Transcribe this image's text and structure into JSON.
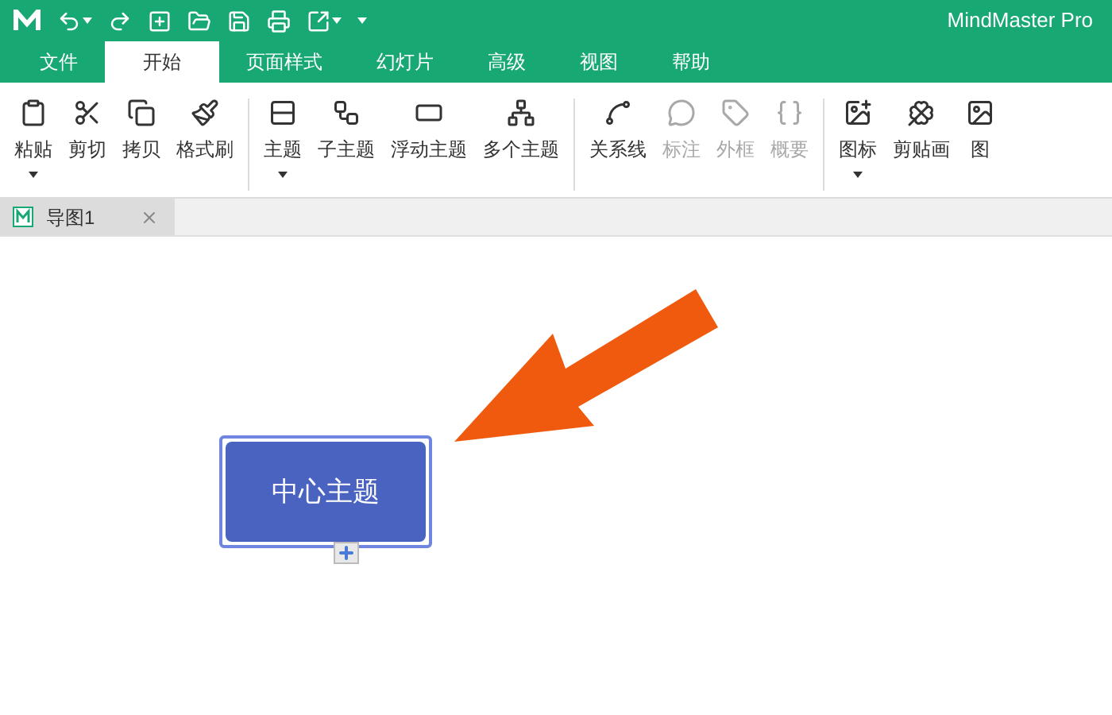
{
  "window": {
    "title": "MindMaster Pro"
  },
  "menu_tabs": [
    {
      "label": "文件",
      "selected": false
    },
    {
      "label": "开始",
      "selected": true
    },
    {
      "label": "页面样式",
      "selected": false
    },
    {
      "label": "幻灯片",
      "selected": false
    },
    {
      "label": "高级",
      "selected": false
    },
    {
      "label": "视图",
      "selected": false
    },
    {
      "label": "帮助",
      "selected": false
    }
  ],
  "ribbon_groups": [
    [
      {
        "label": "粘贴",
        "dropdown": true,
        "disabled": false
      },
      {
        "label": "剪切",
        "dropdown": false,
        "disabled": false
      },
      {
        "label": "拷贝",
        "dropdown": false,
        "disabled": false
      },
      {
        "label": "格式刷",
        "dropdown": false,
        "disabled": false
      }
    ],
    [
      {
        "label": "主题",
        "dropdown": true,
        "disabled": false
      },
      {
        "label": "子主题",
        "dropdown": false,
        "disabled": false
      },
      {
        "label": "浮动主题",
        "dropdown": false,
        "disabled": false
      },
      {
        "label": "多个主题",
        "dropdown": false,
        "disabled": false
      }
    ],
    [
      {
        "label": "关系线",
        "dropdown": false,
        "disabled": false
      },
      {
        "label": "标注",
        "dropdown": false,
        "disabled": true
      },
      {
        "label": "外框",
        "dropdown": false,
        "disabled": true
      },
      {
        "label": "概要",
        "dropdown": false,
        "disabled": true
      }
    ],
    [
      {
        "label": "图标",
        "dropdown": true,
        "disabled": false
      },
      {
        "label": "剪贴画",
        "dropdown": false,
        "disabled": false
      },
      {
        "label": "图",
        "dropdown": false,
        "disabled": false
      }
    ]
  ],
  "document_tabs": [
    {
      "label": "导图1",
      "selected": true
    }
  ],
  "canvas": {
    "central_topic": "中心主题"
  }
}
